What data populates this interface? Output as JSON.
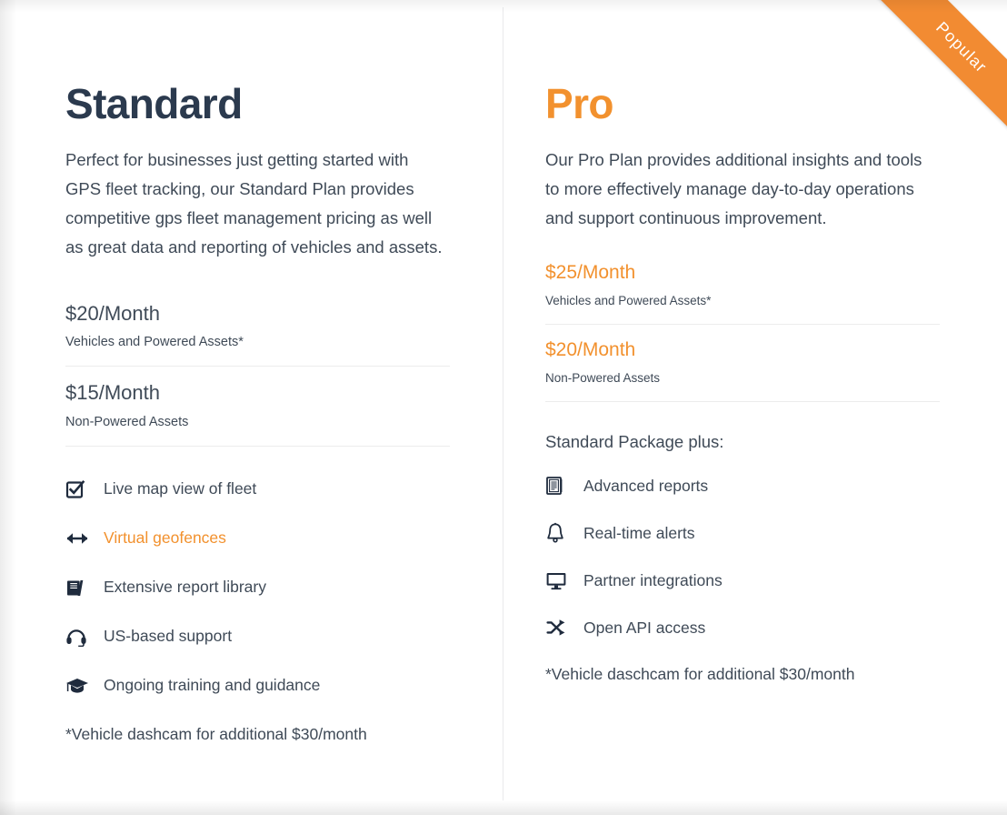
{
  "ribbon": {
    "label": "Popular",
    "color": "#f28b32"
  },
  "colors": {
    "accent_orange": "#f2912e",
    "heading_dark": "#2b3a4e",
    "body_text": "#3f4a57",
    "divider": "#ececec"
  },
  "plans": [
    {
      "id": "standard",
      "title": "Standard",
      "description": "Perfect for businesses just getting started with GPS fleet tracking, our Standard Plan provides competitive gps fleet management pricing as well as great data and reporting of vehicles and assets.",
      "prices": [
        {
          "amount": "$20/Month",
          "label": "Vehicles and Powered Assets*"
        },
        {
          "amount": "$15/Month",
          "label": "Non-Powered Assets"
        }
      ],
      "subhead": "",
      "features": [
        {
          "icon": "checkbox-checked-icon",
          "label": "Live map view of fleet",
          "accent": false
        },
        {
          "icon": "left-right-arrow-icon",
          "label": "Virtual geofences",
          "accent": true
        },
        {
          "icon": "book-icon",
          "label": "Extensive report library",
          "accent": false
        },
        {
          "icon": "headset-icon",
          "label": "US-based support",
          "accent": false
        },
        {
          "icon": "graduation-cap-icon",
          "label": "Ongoing training and guidance",
          "accent": false
        }
      ],
      "footnote": "*Vehicle dashcam for additional $30/month"
    },
    {
      "id": "pro",
      "title": "Pro",
      "description": "Our Pro Plan provides additional insights and tools to more effectively manage day-to-day operations and support continuous improvement.",
      "prices": [
        {
          "amount": "$25/Month",
          "label": "Vehicles and Powered Assets*"
        },
        {
          "amount": "$20/Month",
          "label": "Non-Powered Assets"
        }
      ],
      "subhead": "Standard Package plus:",
      "features": [
        {
          "icon": "clipboard-report-icon",
          "label": "Advanced reports",
          "accent": false
        },
        {
          "icon": "bell-icon",
          "label": "Real-time alerts",
          "accent": false
        },
        {
          "icon": "monitor-icon",
          "label": "Partner integrations",
          "accent": false
        },
        {
          "icon": "shuffle-arrows-icon",
          "label": "Open API access",
          "accent": false
        }
      ],
      "footnote": "*Vehicle daschcam for additional $30/month"
    }
  ]
}
